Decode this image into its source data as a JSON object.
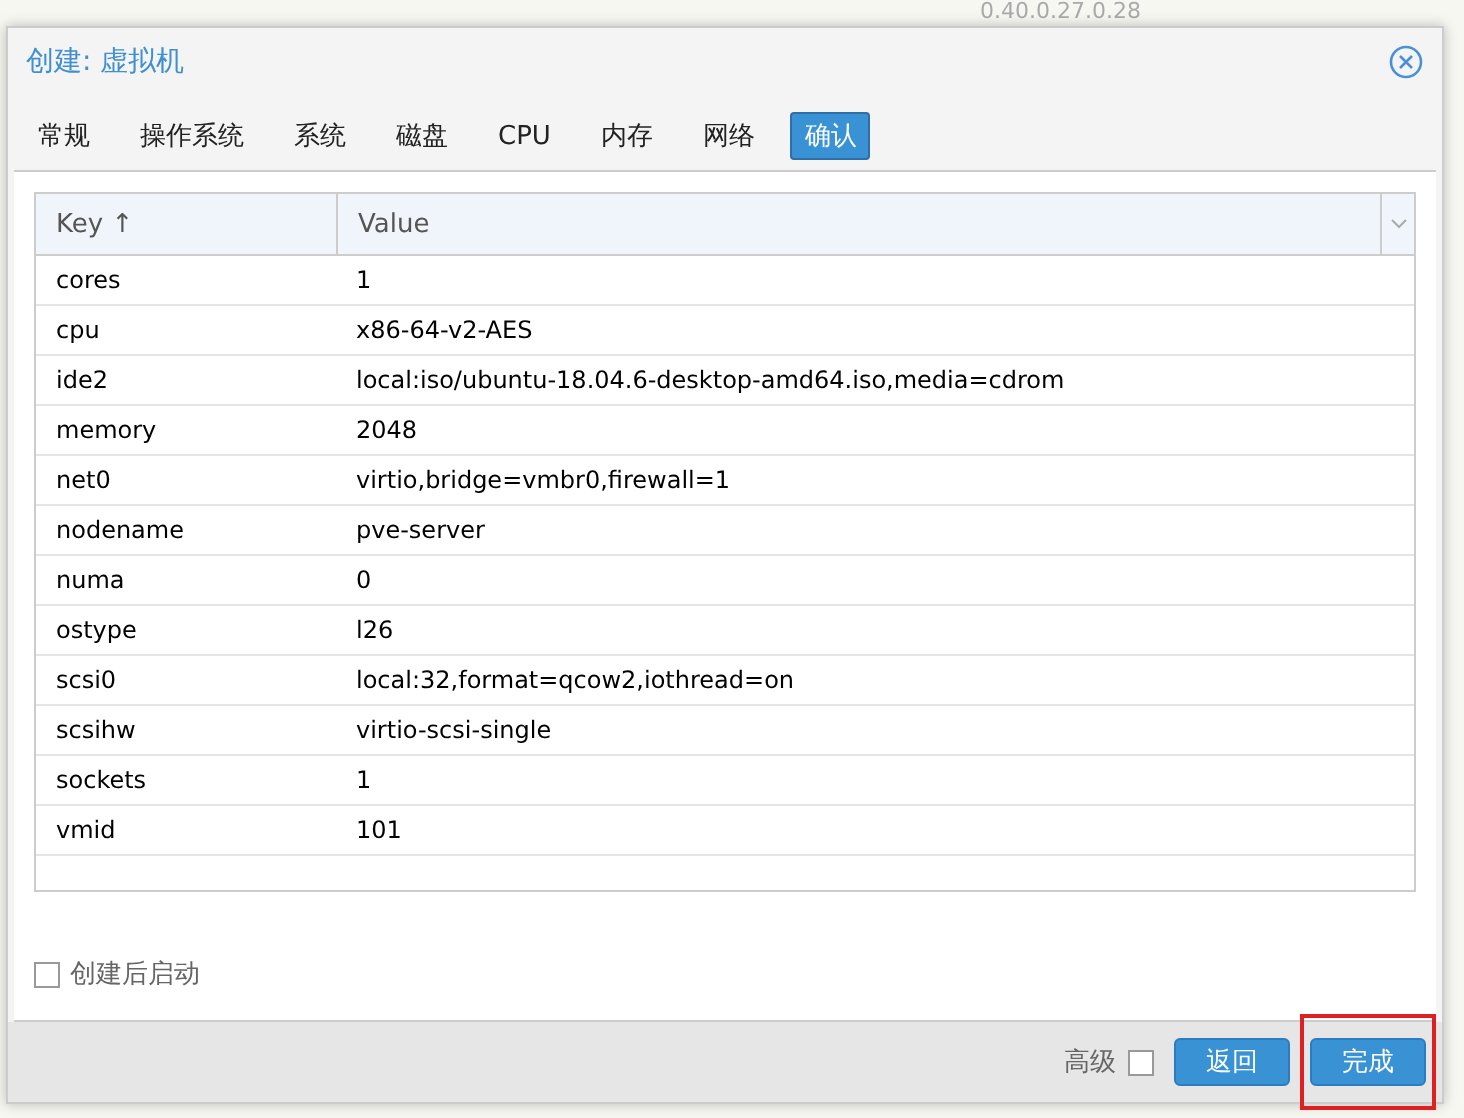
{
  "background_text": "0.40.0.27.0.28",
  "window": {
    "title": "创建: 虚拟机"
  },
  "tabs": [
    {
      "label": "常规",
      "selected": false
    },
    {
      "label": "操作系统",
      "selected": false
    },
    {
      "label": "系统",
      "selected": false
    },
    {
      "label": "磁盘",
      "selected": false
    },
    {
      "label": "CPU",
      "selected": false
    },
    {
      "label": "内存",
      "selected": false
    },
    {
      "label": "网络",
      "selected": false
    },
    {
      "label": "确认",
      "selected": true
    }
  ],
  "table": {
    "columns": [
      "Key ↑",
      "Value"
    ],
    "rows": [
      [
        "cores",
        "1"
      ],
      [
        "cpu",
        "x86-64-v2-AES"
      ],
      [
        "ide2",
        "local:iso/ubuntu-18.04.6-desktop-amd64.iso,media=cdrom"
      ],
      [
        "memory",
        "2048"
      ],
      [
        "net0",
        "virtio,bridge=vmbr0,firewall=1"
      ],
      [
        "nodename",
        "pve-server"
      ],
      [
        "numa",
        "0"
      ],
      [
        "ostype",
        "l26"
      ],
      [
        "scsi0",
        "local:32,format=qcow2,iothread=on"
      ],
      [
        "scsihw",
        "virtio-scsi-single"
      ],
      [
        "sockets",
        "1"
      ],
      [
        "vmid",
        "101"
      ]
    ]
  },
  "start_after_create": {
    "label": "创建后启动",
    "checked": false
  },
  "advanced": {
    "label": "高级",
    "checked": false
  },
  "buttons": [
    {
      "label": "返回",
      "highlighted": false
    },
    {
      "label": "完成",
      "highlighted": true
    }
  ]
}
